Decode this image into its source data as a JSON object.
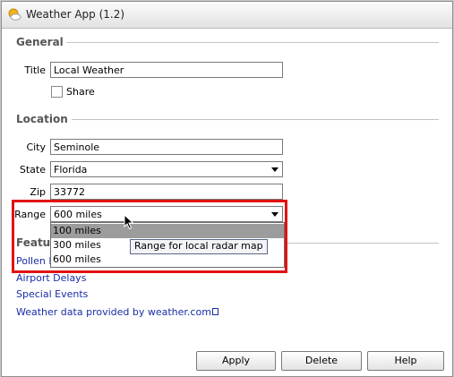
{
  "window": {
    "title": "Weather App (1.2)",
    "icon": "sun-cloud-icon"
  },
  "general": {
    "section_title": "General",
    "title_label": "Title",
    "title_value": "Local Weather",
    "share_label": "Share",
    "share_checked": false
  },
  "location": {
    "section_title": "Location",
    "city_label": "City",
    "city_value": "Seminole",
    "state_label": "State",
    "state_value": "Florida",
    "zip_label": "Zip",
    "zip_value": "33772",
    "range_label": "Range",
    "range_value": "600 miles",
    "range_options": [
      "100 miles",
      "300 miles",
      "600 miles"
    ],
    "range_highlighted_option": "100 miles",
    "range_tooltip": "Range for local radar map"
  },
  "features": {
    "section_title_visible": "Featu",
    "links": [
      "Pollen F",
      "Airport Delays",
      "Special Events",
      "Weather data provided by weather.com"
    ]
  },
  "buttons": {
    "apply": "Apply",
    "delete": "Delete",
    "help": "Help"
  },
  "colors": {
    "highlight_border": "#e21212",
    "link": "#1a2ca8",
    "selected_option": "#9c9c9c"
  }
}
